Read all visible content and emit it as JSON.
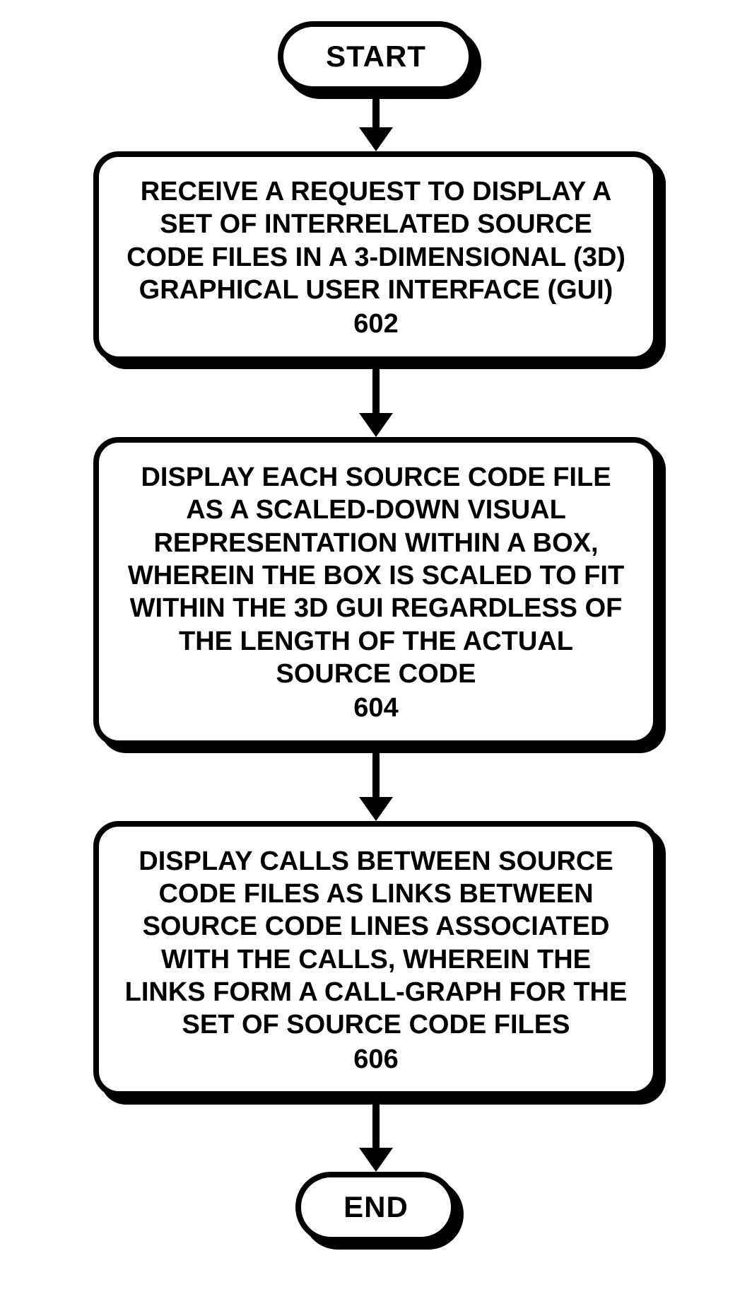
{
  "flowchart": {
    "start": "START",
    "end": "END",
    "steps": [
      {
        "text": "RECEIVE A REQUEST TO DISPLAY A SET OF INTERRELATED SOURCE CODE FILES IN A 3-DIMENSIONAL (3D) GRAPHICAL USER INTERFACE (GUI)",
        "ref": "602"
      },
      {
        "text": "DISPLAY EACH SOURCE CODE FILE AS A SCALED-DOWN VISUAL REPRESENTATION WITHIN A BOX, WHEREIN THE BOX IS SCALED TO FIT WITHIN THE 3D GUI REGARDLESS OF THE LENGTH OF THE ACTUAL SOURCE CODE",
        "ref": "604"
      },
      {
        "text": "DISPLAY CALLS BETWEEN SOURCE CODE FILES AS LINKS BETWEEN SOURCE CODE LINES ASSOCIATED WITH THE CALLS, WHEREIN THE LINKS FORM A CALL-GRAPH FOR THE SET OF SOURCE CODE FILES",
        "ref": "606"
      }
    ]
  },
  "arrow_lengths": {
    "a1": 50,
    "a2": 72,
    "a3": 72,
    "a4": 72
  }
}
